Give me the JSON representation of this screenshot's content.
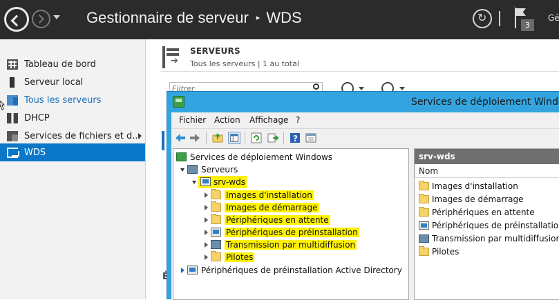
{
  "header": {
    "app_title": "Gestionnaire de serveur",
    "breadcrumb_current": "WDS",
    "separator": "▸",
    "notification_count": "3",
    "manage_menu_clip": "Gé"
  },
  "left_nav": {
    "items": [
      {
        "label": "Tableau de bord",
        "icon": "dashboard-grid-icon"
      },
      {
        "label": "Serveur local",
        "icon": "server-icon"
      },
      {
        "label": "Tous les serveurs",
        "icon": "servers-icon"
      },
      {
        "label": "DHCP",
        "icon": "dhcp-icon"
      },
      {
        "label": "Services de fichiers et d...",
        "icon": "file-services-icon"
      },
      {
        "label": "WDS",
        "icon": "wds-icon"
      }
    ]
  },
  "servers_tile": {
    "title": "SERVEURS",
    "subtitle": "Tous les serveurs | 1 au total",
    "filter_placeholder": "Filtrer",
    "partial_heading": "É"
  },
  "wds_window": {
    "title": "Services de déploiement Windows",
    "menu": [
      "Fichier",
      "Action",
      "Affichage",
      "?"
    ],
    "tree": {
      "root": "Services de déploiement Windows",
      "servers": "Serveurs",
      "server_name": "srv-wds",
      "children": [
        "Images d'installation",
        "Images de démarrage",
        "Périphériques en attente",
        "Périphériques de préinstallation",
        "Transmission par multidiffusion",
        "Pilotes"
      ],
      "ad_prestaged": "Périphériques de préinstallation Active Directory"
    },
    "detail": {
      "header": "srv-wds",
      "column": "Nom",
      "items": [
        "Images d'installation",
        "Images de démarrage",
        "Périphériques en attente",
        "Périphériques de préinstallation",
        "Transmission par multidiffusion",
        "Pilotes"
      ]
    }
  },
  "colors": {
    "title_bar": "#2b2b2b",
    "nav_selected": "#0a77c9",
    "window_frame": "#33a4df",
    "highlight": "#fff200"
  }
}
